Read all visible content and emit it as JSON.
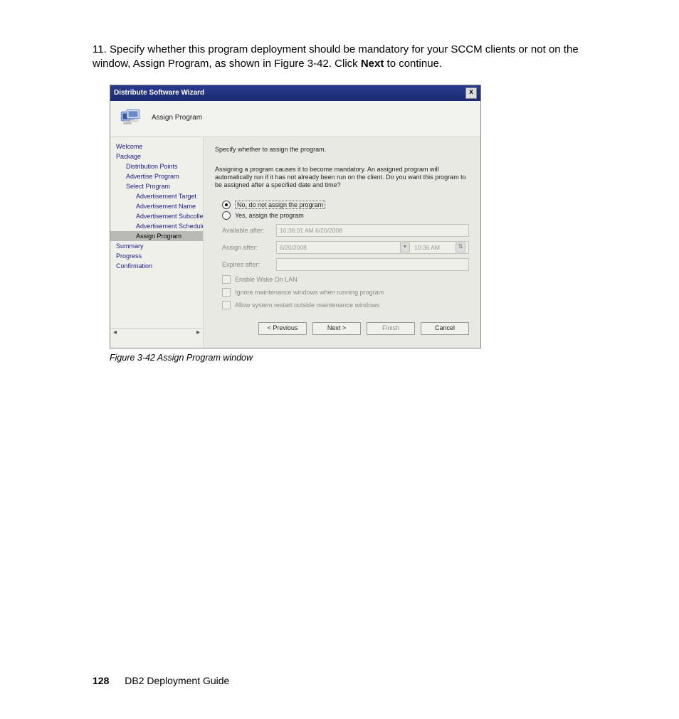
{
  "instruction": {
    "number": "11.",
    "text_1": "Specify whether this program deployment should be mandatory for your SCCM clients or not on the window, Assign Program, as shown in Figure 3-42. Click ",
    "bold": "Next",
    "text_2": " to continue."
  },
  "wizard": {
    "title": "Distribute Software Wizard",
    "close": "x",
    "header_title": "Assign Program",
    "sidebar": {
      "items": [
        {
          "label": "Welcome",
          "level": 0
        },
        {
          "label": "Package",
          "level": 0
        },
        {
          "label": "Distribution Points",
          "level": 1
        },
        {
          "label": "Advertise Program",
          "level": 1
        },
        {
          "label": "Select Program",
          "level": 1
        },
        {
          "label": "Advertisement Target",
          "level": 2
        },
        {
          "label": "Advertisement Name",
          "level": 2
        },
        {
          "label": "Advertisement Subcollec",
          "level": 2
        },
        {
          "label": "Advertisement Schedule",
          "level": 2
        },
        {
          "label": "Assign Program",
          "level": 2,
          "active": true
        },
        {
          "label": "Summary",
          "level": 0
        },
        {
          "label": "Progress",
          "level": 0
        },
        {
          "label": "Confirmation",
          "level": 0
        }
      ]
    },
    "main": {
      "prompt": "Specify whether to assign the program.",
      "desc": "Assigning a program causes it to become mandatory. An assigned program will automatically run if it has not already been run on the client. Do you want this program to be assigned after a specified date and time?",
      "radio_no": "No, do not assign the program",
      "radio_yes": "Yes, assign the program",
      "available_label": "Available after:",
      "available_value": "10:36:01 AM 6/20/2008",
      "assign_label": "Assign after:",
      "assign_date": "6/20/2008",
      "assign_time": "10:36 AM",
      "expires_label": "Expires after:",
      "expires_value": "",
      "chk_wol": "Enable Wake On LAN",
      "chk_ignore": "Ignore maintenance windows when running program",
      "chk_restart": "Allow system restart outside maintenance windows"
    },
    "buttons": {
      "previous": "< Previous",
      "next": "Next >",
      "finish": "Finish",
      "cancel": "Cancel"
    }
  },
  "caption": "Figure 3-42   Assign Program window",
  "footer": {
    "page": "128",
    "doc": "DB2 Deployment Guide"
  }
}
